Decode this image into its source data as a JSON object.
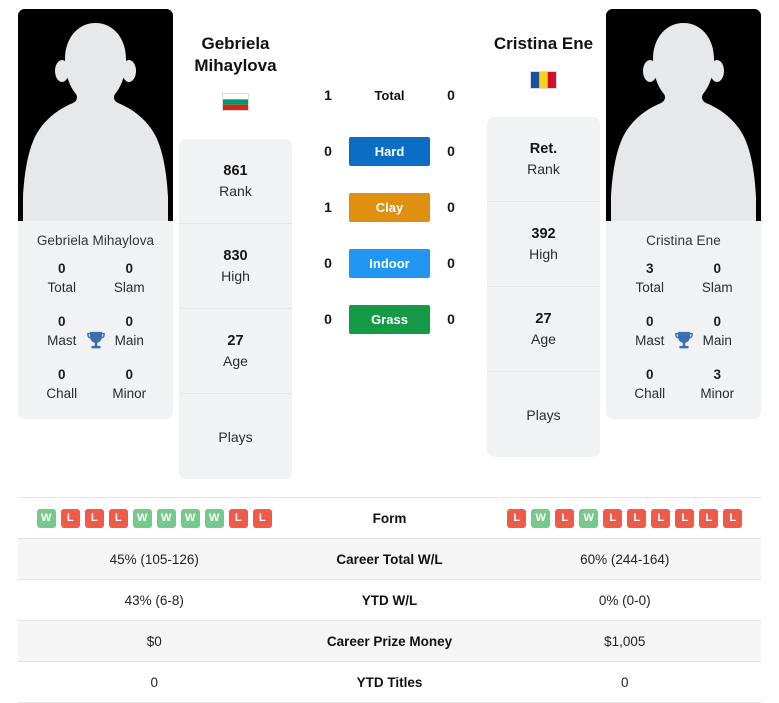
{
  "players": {
    "left": {
      "name": "Gebriela Mihaylova",
      "display_name_line1": "Gebriela",
      "display_name_line2": "Mihaylova",
      "country": "Bulgaria",
      "flag_icon": "flag-bulgaria-icon",
      "avatar_icon": "avatar-placeholder-icon",
      "stats": [
        {
          "value": "861",
          "label": "Rank"
        },
        {
          "value": "830",
          "label": "High"
        },
        {
          "value": "27",
          "label": "Age"
        },
        {
          "value": "",
          "label": "Plays"
        }
      ],
      "titles": [
        {
          "value": "0",
          "label": "Total"
        },
        {
          "value": "0",
          "label": "Slam"
        },
        {
          "value": "0",
          "label": "Mast"
        },
        {
          "value": "0",
          "label": "Main"
        },
        {
          "value": "0",
          "label": "Chall"
        },
        {
          "value": "0",
          "label": "Minor"
        }
      ],
      "form": [
        "W",
        "L",
        "L",
        "L",
        "W",
        "W",
        "W",
        "W",
        "L",
        "L"
      ],
      "career_total_wl": "45% (105-126)",
      "ytd_wl": "43% (6-8)",
      "career_prize_money": "$0",
      "ytd_titles": "0"
    },
    "right": {
      "name": "Cristina Ene",
      "display_name_line1": "Cristina Ene",
      "display_name_line2": "",
      "country": "Romania",
      "flag_icon": "flag-romania-icon",
      "avatar_icon": "avatar-placeholder-icon",
      "stats": [
        {
          "value": "Ret.",
          "label": "Rank"
        },
        {
          "value": "392",
          "label": "High"
        },
        {
          "value": "27",
          "label": "Age"
        },
        {
          "value": "",
          "label": "Plays"
        }
      ],
      "titles": [
        {
          "value": "3",
          "label": "Total"
        },
        {
          "value": "0",
          "label": "Slam"
        },
        {
          "value": "0",
          "label": "Mast"
        },
        {
          "value": "0",
          "label": "Main"
        },
        {
          "value": "0",
          "label": "Chall"
        },
        {
          "value": "3",
          "label": "Minor"
        }
      ],
      "form": [
        "L",
        "W",
        "L",
        "W",
        "L",
        "L",
        "L",
        "L",
        "L",
        "L"
      ],
      "career_total_wl": "60% (244-164)",
      "ytd_wl": "0% (0-0)",
      "career_prize_money": "$1,005",
      "ytd_titles": "0"
    }
  },
  "head_to_head": [
    {
      "label": "Total",
      "left": "1",
      "right": "0",
      "color": "",
      "style": "plain"
    },
    {
      "label": "Hard",
      "left": "0",
      "right": "0",
      "color": "#0b6ec4",
      "style": "badge"
    },
    {
      "label": "Clay",
      "left": "1",
      "right": "0",
      "color": "#e09010",
      "style": "badge"
    },
    {
      "label": "Indoor",
      "left": "0",
      "right": "0",
      "color": "#2196f3",
      "style": "badge"
    },
    {
      "label": "Grass",
      "left": "0",
      "right": "0",
      "color": "#159b45",
      "style": "badge"
    }
  ],
  "comparison_rows": [
    {
      "label": "Form",
      "type": "form",
      "left": "",
      "right": ""
    },
    {
      "label": "Career Total W/L",
      "type": "text",
      "left": "45% (105-126)",
      "right": "60% (244-164)"
    },
    {
      "label": "YTD W/L",
      "type": "text",
      "left": "43% (6-8)",
      "right": "0% (0-0)"
    },
    {
      "label": "Career Prize Money",
      "type": "text",
      "left": "$0",
      "right": "$1,005"
    },
    {
      "label": "YTD Titles",
      "type": "text",
      "left": "0",
      "right": "0"
    }
  ],
  "colors": {
    "win_badge": "#77c98b",
    "loss_badge": "#ef5b4b",
    "trophy": "#3d6fb0",
    "card_bg": "#f1f2f3",
    "row_alt_bg": "#f5f5f5"
  },
  "trophy_icon": "trophy-icon"
}
